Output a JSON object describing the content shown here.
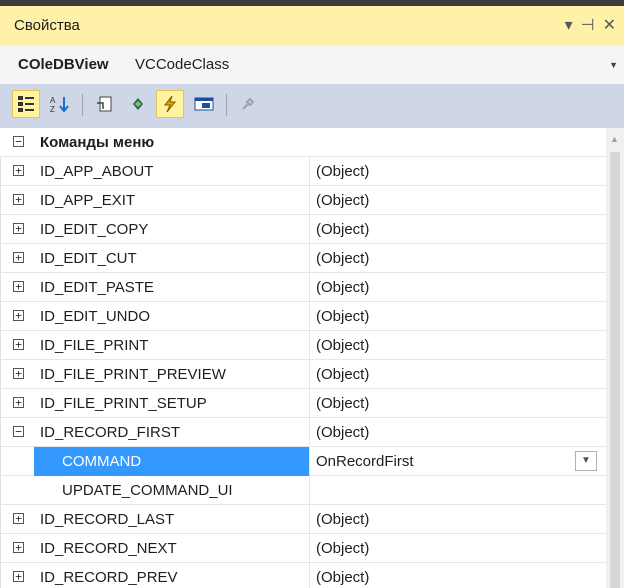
{
  "window": {
    "title": "Свойства",
    "controls": {
      "dropdown": "▾",
      "pin": "⊣",
      "close": "✕"
    }
  },
  "object_selector": {
    "name": "COleDBView",
    "type": "VCCodeClass"
  },
  "toolbar": {
    "buttons": [
      {
        "name": "categorized-icon",
        "active": true
      },
      {
        "name": "alphabetical-icon",
        "active": false
      },
      {
        "name": "properties-icon",
        "active": false
      },
      {
        "name": "events-icon",
        "active": false
      },
      {
        "name": "messages-icon",
        "active": true
      },
      {
        "name": "overrides-icon",
        "active": false
      },
      {
        "name": "property-pages-icon",
        "active": false
      }
    ]
  },
  "grid": {
    "category": {
      "label": "Команды меню",
      "expander": "−"
    },
    "rows": [
      {
        "label": "ID_APP_ABOUT",
        "value": "(Object)",
        "expander": "+"
      },
      {
        "label": "ID_APP_EXIT",
        "value": "(Object)",
        "expander": "+"
      },
      {
        "label": "ID_EDIT_COPY",
        "value": "(Object)",
        "expander": "+"
      },
      {
        "label": "ID_EDIT_CUT",
        "value": "(Object)",
        "expander": "+"
      },
      {
        "label": "ID_EDIT_PASTE",
        "value": "(Object)",
        "expander": "+"
      },
      {
        "label": "ID_EDIT_UNDO",
        "value": "(Object)",
        "expander": "+"
      },
      {
        "label": "ID_FILE_PRINT",
        "value": "(Object)",
        "expander": "+"
      },
      {
        "label": "ID_FILE_PRINT_PREVIEW",
        "value": "(Object)",
        "expander": "+"
      },
      {
        "label": "ID_FILE_PRINT_SETUP",
        "value": "(Object)",
        "expander": "+"
      },
      {
        "label": "ID_RECORD_FIRST",
        "value": "(Object)",
        "expander": "−"
      },
      {
        "label": "COMMAND",
        "value": "OnRecordFirst",
        "child": true,
        "selected": true
      },
      {
        "label": "UPDATE_COMMAND_UI",
        "value": "",
        "child": true
      },
      {
        "label": "ID_RECORD_LAST",
        "value": "(Object)",
        "expander": "+"
      },
      {
        "label": "ID_RECORD_NEXT",
        "value": "(Object)",
        "expander": "+"
      },
      {
        "label": "ID_RECORD_PREV",
        "value": "(Object)",
        "expander": "+"
      }
    ]
  }
}
